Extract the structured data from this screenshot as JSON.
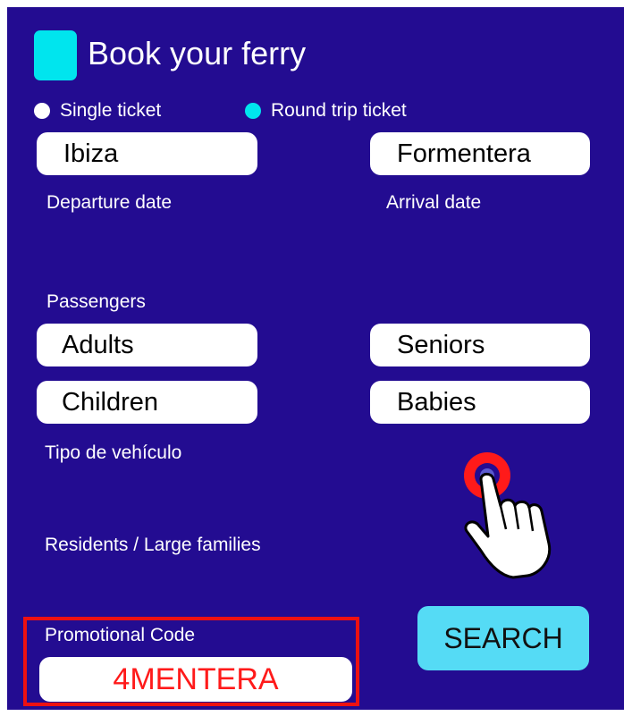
{
  "app": {
    "title": "Book your ferry"
  },
  "trip_type": {
    "single_label": "Single ticket",
    "round_label": "Round trip ticket",
    "selected": "round"
  },
  "route": {
    "origin": "Ibiza",
    "destination": "Formentera"
  },
  "dates": {
    "departure_label": "Departure date",
    "arrival_label": "Arrival date",
    "departure_value": "",
    "arrival_value": ""
  },
  "passengers": {
    "label": "Passengers",
    "adults": "Adults",
    "seniors": "Seniors",
    "children": "Children",
    "babies": "Babies"
  },
  "vehicle": {
    "label": "Tipo de vehículo",
    "value": ""
  },
  "residents": {
    "label": "Residents / Large families",
    "value": ""
  },
  "promo": {
    "label": "Promotional Code",
    "value": "4MENTERA"
  },
  "search": {
    "label": "SEARCH"
  },
  "colors": {
    "background": "#230c91",
    "accent": "#00e5ee",
    "button": "#55dbf5",
    "highlight": "#ee1111"
  },
  "icons": {
    "logo": "ferry-logo-icon",
    "pointer": "hand-pointer-icon",
    "target": "tap-target-icon"
  }
}
